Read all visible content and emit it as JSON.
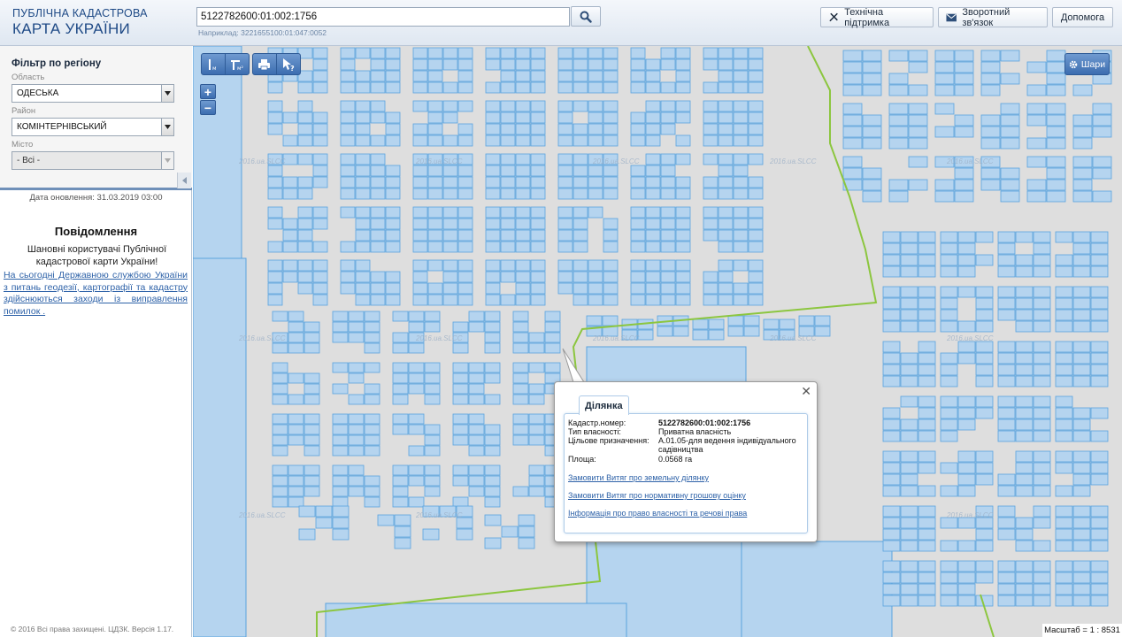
{
  "header": {
    "logo_line1": "ПУБЛІЧНА КАДАСТРОВА",
    "logo_line2": "КАРТА УКРАЇНИ",
    "search_value": "5122782600:01:002:1756",
    "search_hint": "Наприклад: 3221655100:01:047:0052",
    "buttons": {
      "support": "Технічна підтримка",
      "feedback": "Зворотний зв'язок",
      "help": "Допомога"
    }
  },
  "sidebar": {
    "filter_title": "Фільтр по регіону",
    "region_label": "Область",
    "region_value": "ОДЕСЬКА",
    "district_label": "Район",
    "district_value": "КОМІНТЕРНІВСЬКИЙ",
    "city_label": "Місто",
    "city_value": "- Всі -",
    "updated": "Дата оновлення: 31.03.2019 03:00",
    "notice_title": "Повідомлення",
    "notice_body": "Шановні користувачі Публічної кадастрової карти України!",
    "notice_link": "На сьогодні Державною службою України з питань геодезії, картографії та кадастру здійснюються заходи із виправлення помилок .",
    "copyright": "© 2016 Всі права захищені. ЦДЗК. Версія 1.17."
  },
  "map": {
    "layers_label": "Шари",
    "zoom_in": "+",
    "zoom_out": "−",
    "scale": "Масштаб = 1 : 8531",
    "watermark": "2016.ua.SLCC",
    "colors": {
      "parcel_fill": "#b5d4ef",
      "parcel_stroke": "#5aa3de",
      "boundary": "#8cc63f",
      "background": "#dedede"
    }
  },
  "popup": {
    "tab": "Ділянка",
    "rows": [
      {
        "key": "Кадастр.номер:",
        "value": "5122782600:01:002:1756"
      },
      {
        "key": "Тип власності:",
        "value": "Приватна власність"
      },
      {
        "key": "Цільове призначення:",
        "value": "А.01.05-для ведення індивідуального садівництва"
      },
      {
        "key": "Площа:",
        "value": "0.0568 га"
      }
    ],
    "links": [
      "Замовити Витяг про земельну ділянку",
      "Замовити Витяг про нормативну грошову оцінку",
      "Інформація про право власності та речові права"
    ]
  }
}
